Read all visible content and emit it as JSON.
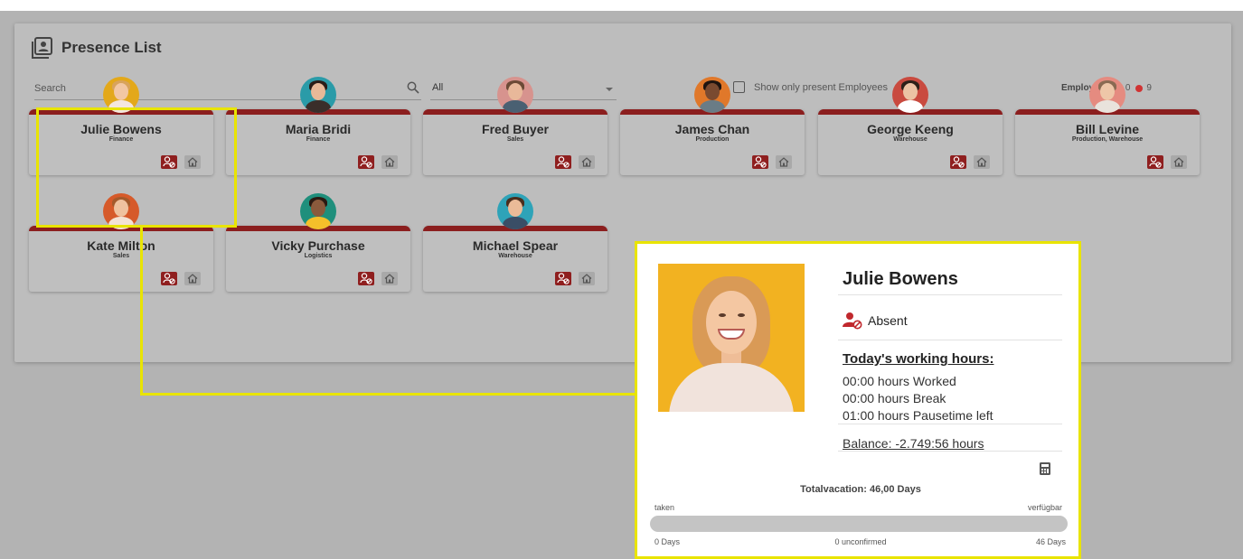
{
  "header": {
    "title": "Presence List"
  },
  "filters": {
    "search_placeholder": "Search",
    "department_selected": "All",
    "show_present_label": "Show only present Employees",
    "show_present_checked": false
  },
  "employee_count": {
    "label": "Employees",
    "present": "0",
    "absent": "9"
  },
  "employees": [
    {
      "name": "Julie Bowens",
      "dept": "Finance",
      "avatar_bg": "#e3a81a",
      "skin": "#f2c7a3",
      "hair": "#d8a35b",
      "shirt": "#f4e6df"
    },
    {
      "name": "Maria Bridi",
      "dept": "Finance",
      "avatar_bg": "#2a9ba8",
      "skin": "#e7b998",
      "hair": "#2a1d17",
      "shirt": "#3a2e2a"
    },
    {
      "name": "Fred Buyer",
      "dept": "Sales",
      "avatar_bg": "#d7938e",
      "skin": "#e8b89a",
      "hair": "#6c4a36",
      "shirt": "#4a6072"
    },
    {
      "name": "James Chan",
      "dept": "Production",
      "avatar_bg": "#e0782a",
      "skin": "#7a4a30",
      "hair": "#1f1410",
      "shirt": "#6a7c86"
    },
    {
      "name": "George Keeng",
      "dept": "Warehouse",
      "avatar_bg": "#c94a3f",
      "skin": "#ecc3a4",
      "hair": "#2c2018",
      "shirt": "#ffffff"
    },
    {
      "name": "Bill Levine",
      "dept": "Production, Warehouse",
      "avatar_bg": "#e58b80",
      "skin": "#eec6a8",
      "hair": "#8a6a52",
      "shirt": "#e9e3dc"
    },
    {
      "name": "Kate Milton",
      "dept": "Sales",
      "avatar_bg": "#d65a2a",
      "skin": "#efc29f",
      "hair": "#a45a2c",
      "shirt": "#f3e2d5"
    },
    {
      "name": "Vicky Purchase",
      "dept": "Logistics",
      "avatar_bg": "#1f8f7c",
      "skin": "#8a5a3c",
      "hair": "#2a1a12",
      "shirt": "#f5c02a"
    },
    {
      "name": "Michael Spear",
      "dept": "Warehouse",
      "avatar_bg": "#2ea3b8",
      "skin": "#eabb98",
      "hair": "#4a2e1e",
      "shirt": "#3a4e66"
    }
  ],
  "popup": {
    "name": "Julie Bowens",
    "status": "Absent",
    "working_hours_title": "Today's working hours:",
    "worked": "00:00 hours Worked",
    "break_time": "00:00 hours Break",
    "pause_left": "01:00 hours Pausetime left",
    "balance": "Balance: -2.749:56 hours",
    "vacation_title": "Totalvacation: 46,00 Days",
    "taken_label": "taken",
    "available_label": "verfügbar",
    "start_label": "0 Days",
    "unconfirmed_label": "0 unconfirmed",
    "end_label": "46 Days",
    "taken_fraction": 0
  },
  "colors": {
    "accent_red": "#8b1e1e",
    "highlight": "#e9e400",
    "present": "#3aa455",
    "absent": "#d03333"
  }
}
